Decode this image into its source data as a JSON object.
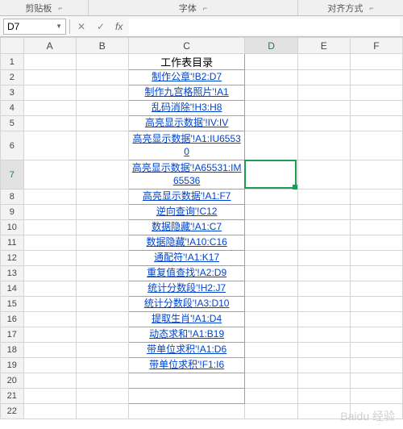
{
  "ribbon": {
    "group1": "剪贴板",
    "group2": "字体",
    "group3": "对齐方式",
    "launcher_glyph": "⌐"
  },
  "namebox": {
    "value": "D7",
    "drop_glyph": "▼"
  },
  "fx": {
    "cancel": "✕",
    "confirm": "✓",
    "label": "fx"
  },
  "columns": [
    "A",
    "B",
    "C",
    "D",
    "E",
    "F"
  ],
  "active": {
    "row": 7,
    "col": "D"
  },
  "rows": [
    {
      "n": 1,
      "c": "工作表目录",
      "type": "title"
    },
    {
      "n": 2,
      "c": "制作公章'!B2:D7",
      "type": "link"
    },
    {
      "n": 3,
      "c": "制作九宫格照片'!A1",
      "type": "link"
    },
    {
      "n": 4,
      "c": "乱码消除'!H3:H8",
      "type": "link"
    },
    {
      "n": 5,
      "c": "高亮显示数据'!IV:IV",
      "type": "link"
    },
    {
      "n": 6,
      "c": "高亮显示数据'!A1:IU65530",
      "type": "link",
      "two": true
    },
    {
      "n": 7,
      "c": "高亮显示数据'!A65531:IM65536",
      "type": "link",
      "two": true
    },
    {
      "n": 8,
      "c": "高亮显示数据'!A1:F7",
      "type": "link"
    },
    {
      "n": 9,
      "c": "逆向查询'!C12",
      "type": "link"
    },
    {
      "n": 10,
      "c": "数据隐藏'!A1:C7",
      "type": "link"
    },
    {
      "n": 11,
      "c": "数据隐藏'!A10:C16",
      "type": "link"
    },
    {
      "n": 12,
      "c": "通配符'!A1:K17",
      "type": "link"
    },
    {
      "n": 13,
      "c": "重复值查找'!A2:D9",
      "type": "link"
    },
    {
      "n": 14,
      "c": "统计分数段'!H2:J7",
      "type": "link"
    },
    {
      "n": 15,
      "c": "统计分数段'!A3:D10",
      "type": "link"
    },
    {
      "n": 16,
      "c": "提取生肖'!A1:D4",
      "type": "link"
    },
    {
      "n": 17,
      "c": "动态求和'!A1:B19",
      "type": "link"
    },
    {
      "n": 18,
      "c": "带单位求积'!A1:D6",
      "type": "link"
    },
    {
      "n": 19,
      "c": "带单位求积'!F1:I6",
      "type": "link"
    },
    {
      "n": 20,
      "c": "",
      "type": "box"
    },
    {
      "n": 21,
      "c": "",
      "type": "box"
    },
    {
      "n": 22,
      "c": "",
      "type": "empty"
    }
  ],
  "watermark": "Baidu 经验"
}
